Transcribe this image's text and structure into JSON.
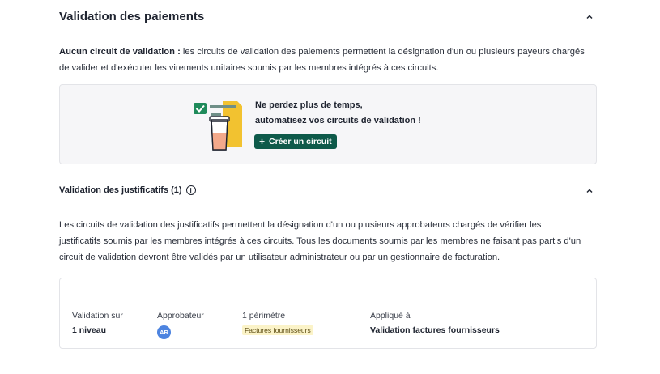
{
  "payments_section": {
    "title": "Validation des paiements",
    "intro_bold": "Aucun circuit de validation :",
    "intro_line1": " les circuits de validation des paiements permettent la désignation d'un ou plusieurs payeurs chargés",
    "intro_line2": "de valider et d'exécuter les virements unitaires soumis par les membres intégrés à ces circuits.",
    "promo": {
      "line1": "Ne perdez plus de temps,",
      "line2": "automatisez vos circuits de validation !",
      "button_label": "Créer un circuit",
      "button_icon": "plus-icon"
    }
  },
  "receipts_section": {
    "title": "Validation des justificatifs (1)",
    "info_icon": "info-icon",
    "description_line1": "Les circuits de validation des justificatifs permettent la désignation d'un ou plusieurs approbateurs chargés de vérifier les",
    "description_line2": "justificatifs soumis par les membres intégrés à ces circuits. Tous les documents soumis par les membres ne faisant pas partis d'un",
    "description_line3": "circuit de validation devront être validés par un utilisateur administrateur ou par un gestionnaire de facturation.",
    "circuit": {
      "level_label": "Validation sur",
      "level_value": "1 niveau",
      "approver_label": "Approbateur",
      "approver_initials": "AR",
      "perimeter_label": "1 périmètre",
      "perimeter_tag": "Factures fournisseurs",
      "applied_label": "Appliqué à",
      "applied_value": "Validation factures fournisseurs"
    }
  },
  "colors": {
    "accent": "#0e5a4a",
    "avatar": "#4d84e0",
    "tag_bg": "#fbf3c8",
    "card_bg": "#f6f6f8"
  }
}
